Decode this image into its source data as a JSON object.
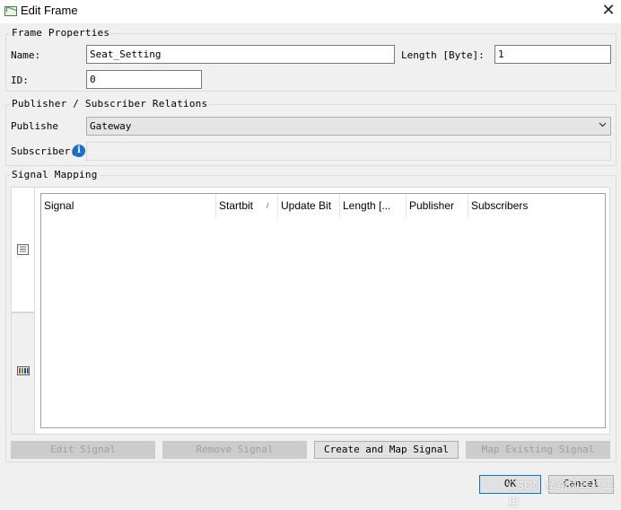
{
  "window": {
    "title": "Edit Frame",
    "icon": "frame-edit-icon",
    "close_glyph": "✕"
  },
  "frame_properties": {
    "title": "Frame Properties",
    "name_label": "Name:",
    "name_value": "Seat_Setting",
    "length_label": "Length [Byte]:",
    "length_value": "1",
    "id_label": "ID:",
    "id_value": "0"
  },
  "relations": {
    "title": "Publisher / Subscriber Relations",
    "publisher_label": "Publishe",
    "publisher_value": "Gateway",
    "subscriber_label": "Subscriber(",
    "subscriber_value": ""
  },
  "signal_mapping": {
    "title": "Signal Mapping",
    "tabs": [
      {
        "icon": "list-view-icon",
        "active": true
      },
      {
        "icon": "bit-layout-icon",
        "active": false
      }
    ],
    "columns": [
      "Signal",
      "Startbit",
      "Update Bit",
      "Length [...",
      "Publisher",
      "Subscribers"
    ],
    "sort_glyph": "/",
    "rows": []
  },
  "buttons": {
    "edit_signal": "Edit Signal",
    "remove_signal": "Remove Signal",
    "create_map_signal": "Create and Map Signal",
    "map_existing_signal": "Map Existing Signal",
    "ok": "OK",
    "cancel": "Cancel"
  },
  "watermark": "CSDN @路由器打工用",
  "colors": {
    "accent": "#0078d7",
    "info": "#1a6fd1",
    "background": "#f0f0f0"
  }
}
